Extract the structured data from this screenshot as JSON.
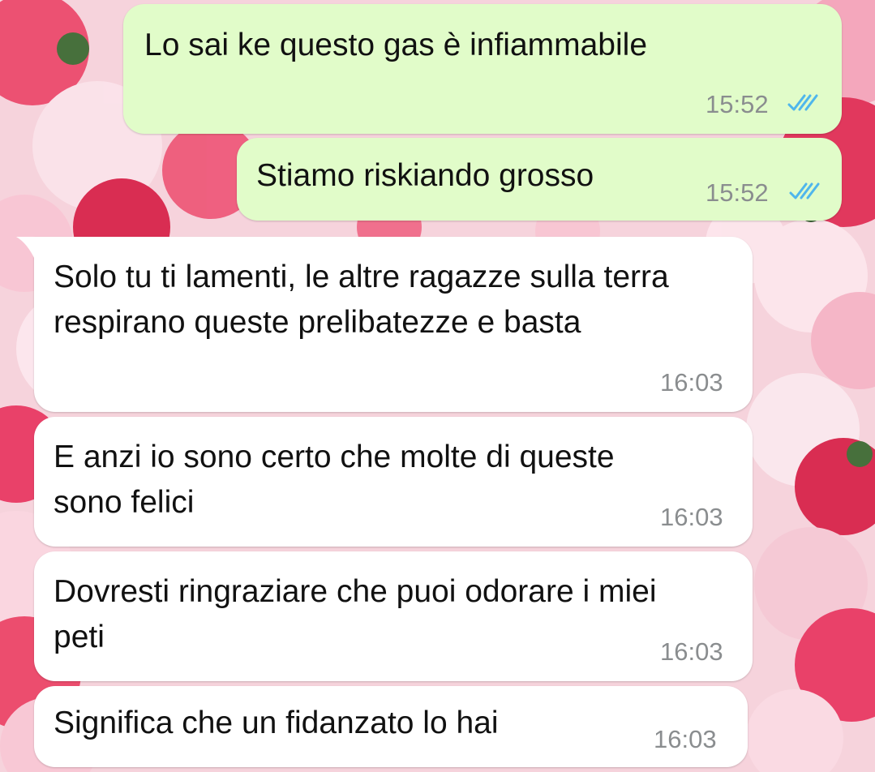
{
  "chat": {
    "messages": [
      {
        "direction": "outgoing",
        "text": "Lo sai ke questo gas è infiammabile",
        "time": "15:52",
        "status": "read",
        "ticks_icon": "double-check-icon"
      },
      {
        "direction": "outgoing",
        "text": "Stiamo riskiando grosso",
        "time": "15:52",
        "status": "read",
        "ticks_icon": "double-check-icon"
      },
      {
        "direction": "incoming",
        "text": "Solo tu ti lamenti, le altre ragazze sulla terra respirano queste prelibatezze e basta",
        "time": "16:03"
      },
      {
        "direction": "incoming",
        "text": "E anzi io sono certo che molte di queste sono felici",
        "time": "16:03"
      },
      {
        "direction": "incoming",
        "text": "Dovresti ringraziare che puoi odorare i miei peti",
        "time": "16:03"
      },
      {
        "direction": "incoming",
        "text": "Significa che un fidanzato lo hai",
        "time": "16:03"
      }
    ]
  },
  "colors": {
    "outgoing_bubble": "#e1fcc9",
    "incoming_bubble": "#ffffff",
    "read_ticks": "#4fb6ec",
    "timestamp": "#8a8d8f"
  }
}
